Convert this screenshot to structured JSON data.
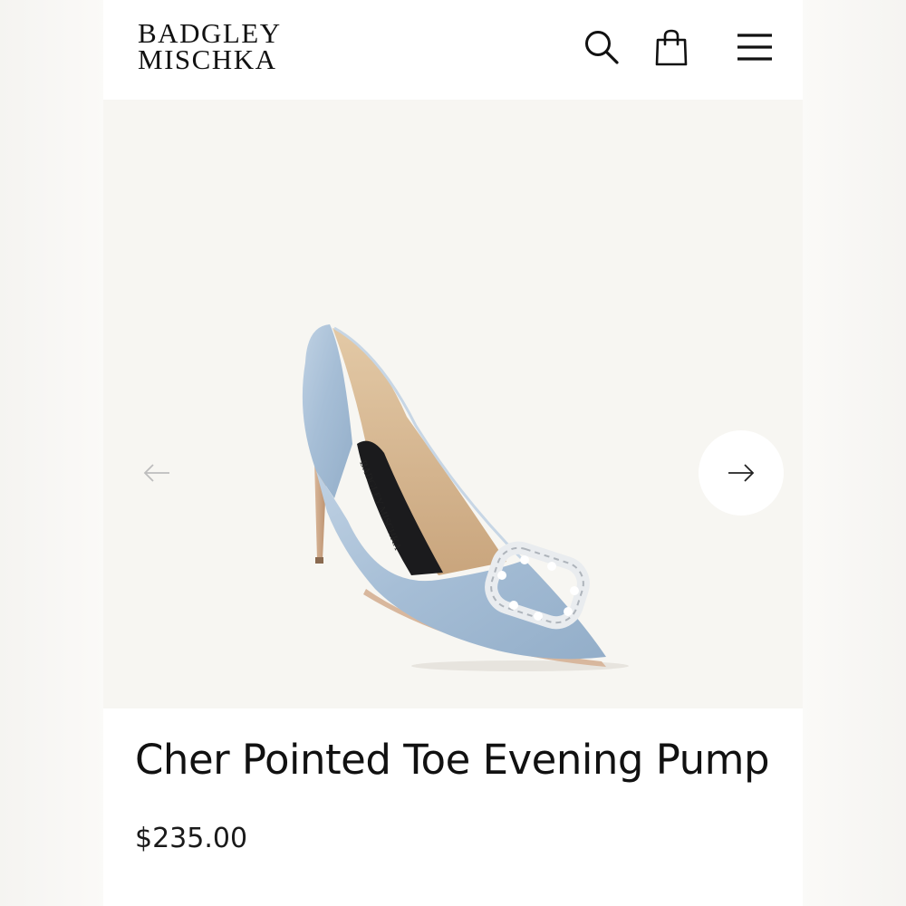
{
  "brand": {
    "line1": "BADGLEY",
    "line2": "MISCHKA"
  },
  "header": {
    "icons": [
      "search-icon",
      "shopping-bag-icon",
      "hamburger-menu-icon"
    ]
  },
  "gallery": {
    "image_alt": "Cher Pointed Toe Evening Pump",
    "prev_icon": "arrow-left-icon",
    "next_icon": "arrow-right-icon",
    "insole_label": "BADGLEY MISCHKA"
  },
  "product": {
    "title": "Cher Pointed Toe Evening Pump",
    "price": "$235.00"
  },
  "colors": {
    "shoe_satin": "#a9c1d8",
    "background": "#f7f6f2",
    "text": "#111111"
  }
}
